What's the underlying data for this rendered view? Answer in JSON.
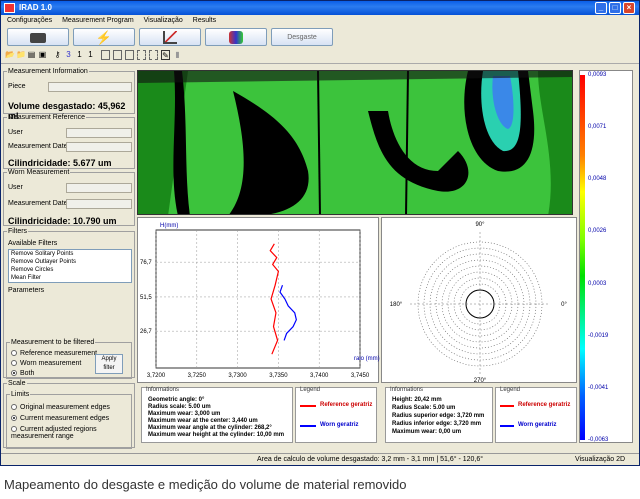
{
  "window": {
    "title": "IRAD 1.0"
  },
  "menu": [
    "Configurações",
    "Measurement Program",
    "Visualização",
    "Results"
  ],
  "big_toolbar": {
    "desgaste_label": "Desgaste"
  },
  "left": {
    "measurement_info": {
      "legend": "Measurement Information",
      "piece_label": "Piece",
      "volume_text": "Volume desgastado: 45,962 ml"
    },
    "reference": {
      "legend": "Measurement Reference",
      "user_label": "User",
      "date_label": "Measurement Date",
      "cyl_text": "Cilindricidade: 5.677 um"
    },
    "worn": {
      "legend": "Worn Measurement",
      "user_label": "User",
      "date_label": "Measurement Date",
      "cyl_text": "Cilindricidade: 10.790 um"
    },
    "filters": {
      "legend": "Filters",
      "available_label": "Available Filters",
      "items": [
        "Remove Solitary Points",
        "Remove Outlayer Points",
        "Remove Circles",
        "Mean Filter"
      ],
      "parameters_label": "Parameters"
    },
    "measurement_filtered": {
      "legend": "Measurement to be filtered",
      "options": [
        "Reference measurement",
        "Worn measurement",
        "Both"
      ],
      "selected": 2,
      "apply_label": "Apply filter"
    },
    "scale": {
      "legend": "Scale",
      "limits_label": "Limits",
      "options": [
        "Original measurement edges",
        "Current measurement edges",
        "Current adjusted regions measurement range"
      ],
      "selected": 1
    }
  },
  "colorbar": {
    "ticks": [
      "0,0093",
      "0,0071",
      "0,0048",
      "0,0026",
      "0,0003",
      "-0,0019",
      "-0,0041",
      "-0,0063"
    ]
  },
  "plot": {
    "ylabel": "H(mm)",
    "y_ticks": [
      "76,7",
      "51,5",
      "26,7"
    ],
    "x_ticks": [
      "3,7200",
      "3,7250",
      "3,7300",
      "3,7350",
      "3,7400",
      "3,7450"
    ],
    "xlabel": "raio (mm)"
  },
  "polar": {
    "top_label": "90°",
    "bottom_label": "270°",
    "left_label": "180°",
    "right_label": "0°"
  },
  "info1": {
    "header": "Informations",
    "rows": [
      "Geometric angle: 0°",
      "Radius scale: 5.00 um",
      "Maximum wear: 3,000 um",
      "Maximum wear at the center: 3,440 um",
      "Maximum wear angle at the cylinder: 268,2°",
      "Maximum wear height at the cylinder: 10,00 mm"
    ]
  },
  "legend1": {
    "header": "Legend",
    "items": [
      {
        "label": "Reference geratriz",
        "color": "#ff0000"
      },
      {
        "label": "Worn geratriz",
        "color": "#0000ff"
      }
    ]
  },
  "info2": {
    "header": "Informations",
    "rows": [
      "Height: 20,42 mm",
      "Radius Scale: 5.00 um",
      "Radius superior edge: 3,720 mm",
      "Radius inferior edge: 3,720 mm",
      "Maximum wear: 0,00 um"
    ]
  },
  "legend2": {
    "header": "Legend",
    "items": [
      {
        "label": "Reference geratriz",
        "color": "#ff0000"
      },
      {
        "label": "Worn geratriz",
        "color": "#0000ff"
      }
    ]
  },
  "status": {
    "left": "Area de calculo de volume desgastado: 3,2 mm - 3,1 mm | 51,6° - 120,6°",
    "right": "Visualização 2D"
  },
  "caption": "Mapeamento do desgaste e medição do volume de material removido",
  "chart_data": {
    "type": "line",
    "ylabel": "H(mm)",
    "xlabel": "raio (mm)",
    "xlim": [
      3.72,
      3.745
    ],
    "series": [
      {
        "name": "Reference geratriz",
        "color": "#ff0000",
        "x": [
          3.7345,
          3.734,
          3.7348,
          3.7343,
          3.735,
          3.7346,
          3.7341,
          3.7347,
          3.7344,
          3.7349,
          3.7342
        ],
        "y": [
          90,
          85,
          80,
          75,
          70,
          60,
          50,
          40,
          30,
          20,
          10
        ]
      },
      {
        "name": "Worn geratriz",
        "color": "#0000ff",
        "x": [
          3.7355,
          3.7352,
          3.7358,
          3.7362,
          3.737,
          3.7372,
          3.7368,
          3.736,
          3.7357
        ],
        "y": [
          60,
          55,
          50,
          45,
          40,
          35,
          30,
          25,
          20
        ]
      }
    ]
  }
}
